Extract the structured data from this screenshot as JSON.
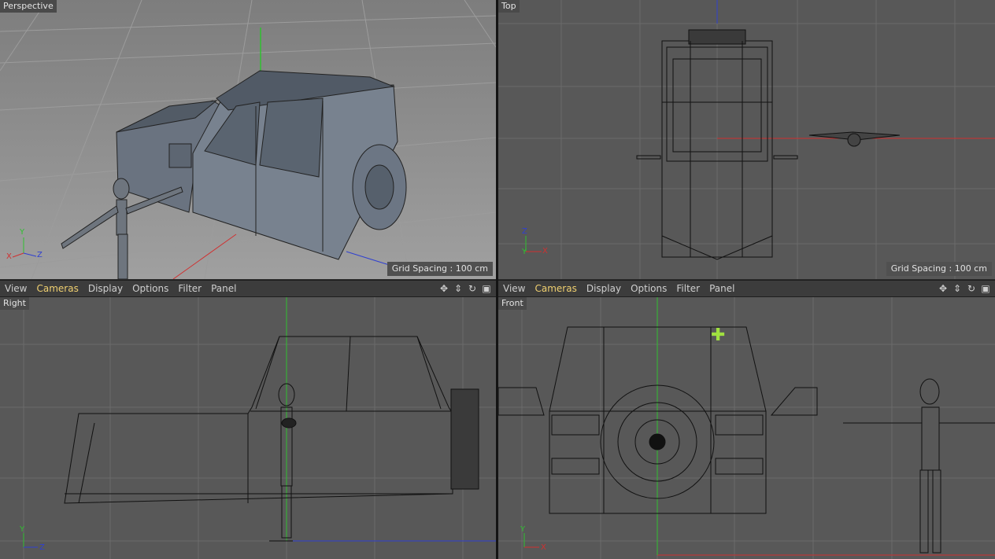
{
  "viewports": {
    "perspective": {
      "label": "Perspective",
      "grid_spacing": "Grid Spacing : 100 cm"
    },
    "top": {
      "label": "Top",
      "grid_spacing": "Grid Spacing : 100 cm"
    },
    "right": {
      "label": "Right"
    },
    "front": {
      "label": "Front"
    }
  },
  "menus": {
    "left": {
      "view": "View",
      "cameras": "Cameras",
      "display": "Display",
      "options": "Options",
      "filter": "Filter",
      "panel": "Panel"
    },
    "right": {
      "view": "View",
      "cameras": "Cameras",
      "display": "Display",
      "options": "Options",
      "filter": "Filter",
      "panel": "Panel"
    }
  },
  "axes": {
    "x": "X",
    "y": "Y",
    "z": "Z"
  },
  "icons": [
    "move-view-icon",
    "zoom-view-icon",
    "rotate-view-icon",
    "maximize-view-icon"
  ],
  "colors": {
    "x_axis": "#d03030",
    "y_axis": "#30c030",
    "z_axis": "#3040d0",
    "accent": "#f0d070"
  }
}
